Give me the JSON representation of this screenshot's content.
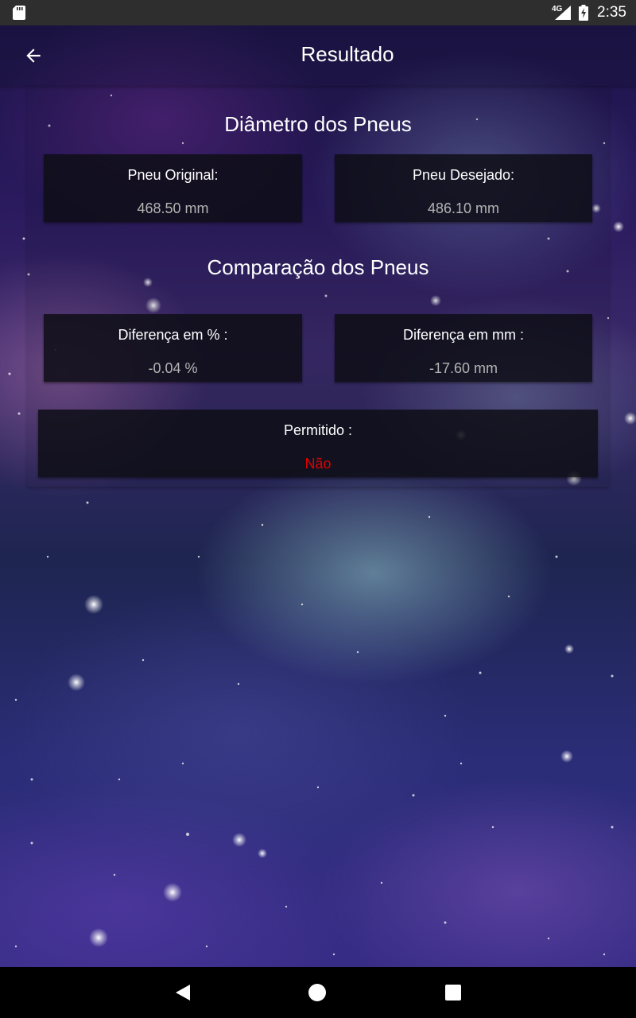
{
  "status_bar": {
    "network": "4G",
    "time": "2:35",
    "icons": [
      "sd-card-icon",
      "signal-icon",
      "battery-charging-icon"
    ]
  },
  "app_bar": {
    "title": "Resultado",
    "back_icon": "arrow-back-icon"
  },
  "diameter_section": {
    "title": "Diâmetro dos Pneus",
    "original_label": "Pneu Original:",
    "original_value": "468.50 mm",
    "desired_label": "Pneu Desejado:",
    "desired_value": "486.10 mm"
  },
  "comparison_section": {
    "title": "Comparação dos Pneus",
    "percent_label": "Diferença em % :",
    "percent_value": "-0.04 %",
    "mm_label": "Diferença em mm :",
    "mm_value": "-17.60 mm",
    "allowed_label": "Permitido :",
    "allowed_value": "Não",
    "allowed_value_color": "#e00000"
  },
  "nav_bar": {
    "icons": [
      "nav-back-icon",
      "nav-home-icon",
      "nav-recents-icon"
    ]
  }
}
